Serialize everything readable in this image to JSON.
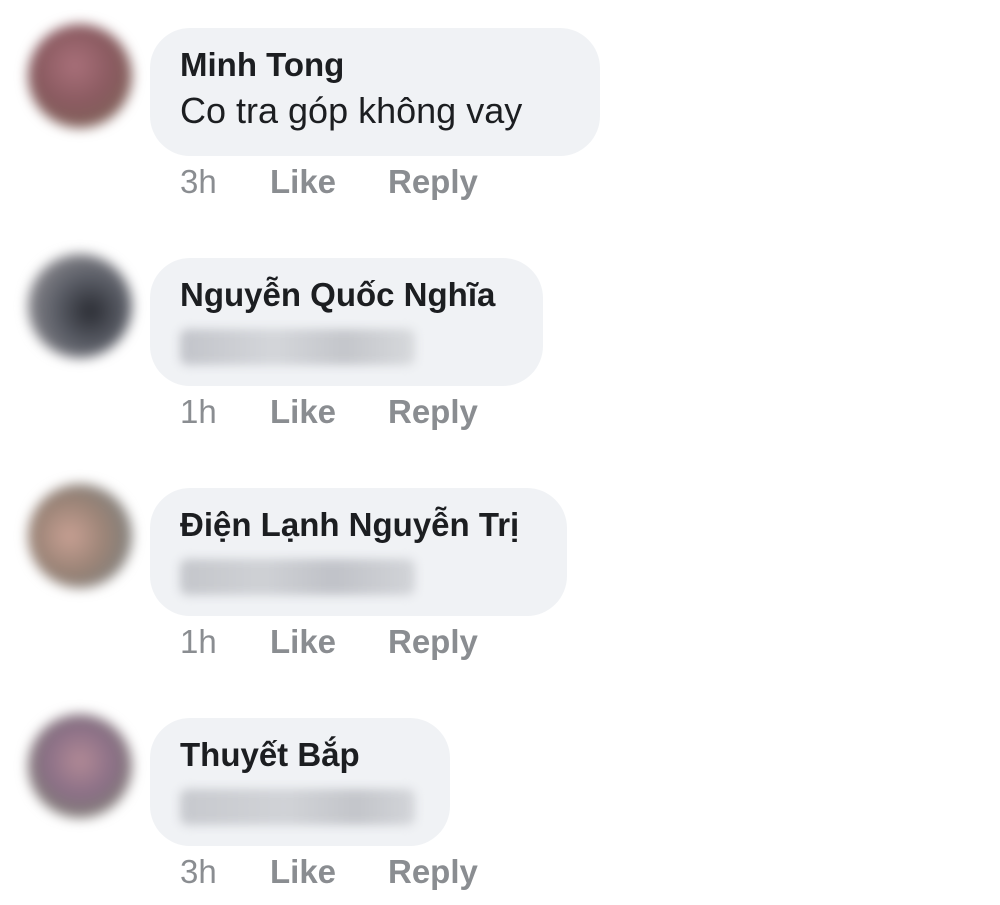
{
  "comments": [
    {
      "author": "Minh Tong",
      "text": "Co tra góp không vay",
      "time": "3h",
      "like_label": "Like",
      "reply_label": "Reply",
      "avatar_color": "#8a5a60",
      "text_redacted": false
    },
    {
      "author": "Nguyễn Quốc Nghĩa",
      "text": "",
      "time": "1h",
      "like_label": "Like",
      "reply_label": "Reply",
      "avatar_color": "#5a5d66",
      "text_redacted": true
    },
    {
      "author": "Điện Lạnh Nguyễn Trị",
      "text": "",
      "time": "1h",
      "like_label": "Like",
      "reply_label": "Reply",
      "avatar_color": "#9a8376",
      "text_redacted": true
    },
    {
      "author": "Thuyết Bắp",
      "text": "",
      "time": "3h",
      "like_label": "Like",
      "reply_label": "Reply",
      "avatar_color": "#8a6f86",
      "text_redacted": true
    }
  ],
  "colors": {
    "bubble": "#f0f2f5",
    "action_text": "#8a8d91",
    "author_text": "#1c1e21",
    "redaction": "#c9cbd0"
  }
}
